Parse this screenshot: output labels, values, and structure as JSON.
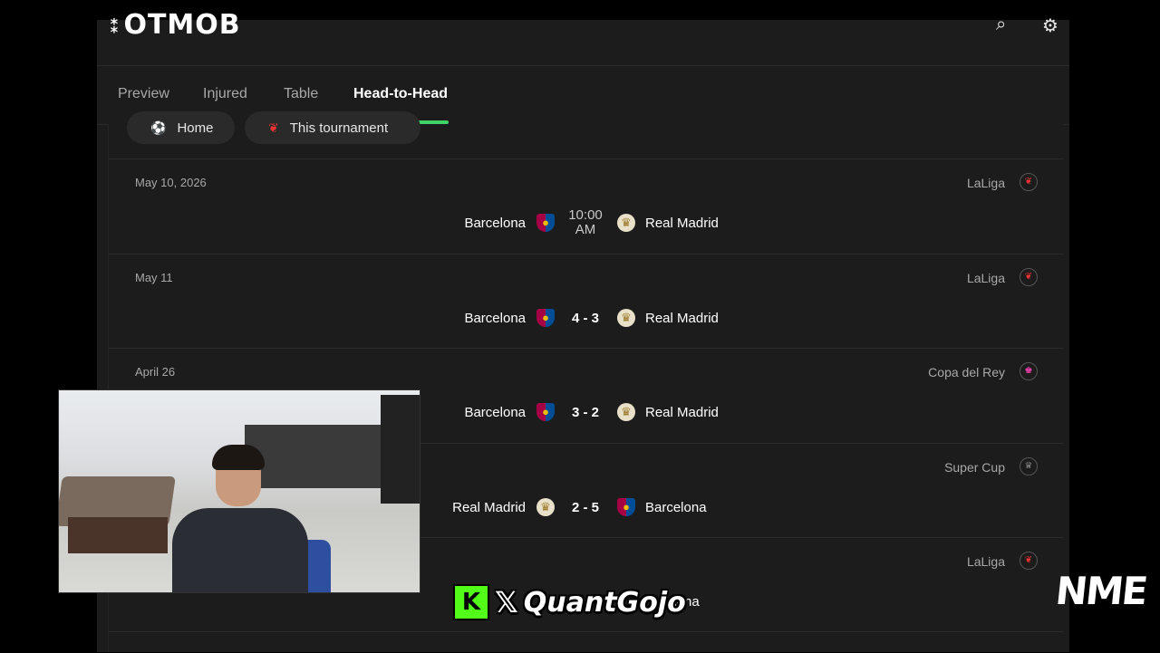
{
  "header": {
    "logo_text": "OTMOB",
    "search_icon": "search-icon",
    "settings_icon": "gear-icon"
  },
  "tabs": [
    {
      "label": "Preview",
      "active": false
    },
    {
      "label": "Injured",
      "active": false
    },
    {
      "label": "Table",
      "active": false
    },
    {
      "label": "Head-to-Head",
      "active": true
    }
  ],
  "filters": [
    {
      "label": "Home",
      "icon": "real-madrid-crest-icon"
    },
    {
      "label": "This tournament",
      "icon": "laliga-icon"
    }
  ],
  "matches": [
    {
      "date": "May 10, 2026",
      "competition": "LaLiga",
      "home": "Barcelona",
      "away": "Real Madrid",
      "time_line1": "10:00",
      "time_line2": "AM",
      "score": ""
    },
    {
      "date": "May 11",
      "competition": "LaLiga",
      "home": "Barcelona",
      "away": "Real Madrid",
      "score": "4 - 3"
    },
    {
      "date": "April 26",
      "competition": "Copa del Rey",
      "home": "Barcelona",
      "away": "Real Madrid",
      "score": "3 - 2"
    },
    {
      "date": "",
      "competition": "Super Cup",
      "home": "Real Madrid",
      "away": "Barcelona",
      "score": "2 - 5"
    },
    {
      "date": "",
      "competition": "LaLiga",
      "home": "",
      "away": "elona",
      "score": ""
    }
  ],
  "overlay": {
    "handle": "QuantGojo",
    "kick_logo": "K",
    "x_logo": "𝕏",
    "watermark": "NME"
  },
  "colors": {
    "accent": "#3fd36a",
    "background": "#1c1c1c",
    "kick_green": "#53fc18"
  }
}
